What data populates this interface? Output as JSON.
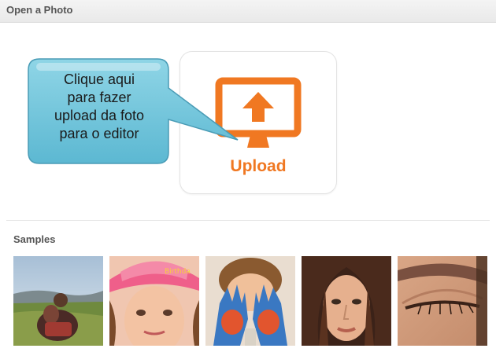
{
  "header": {
    "title": "Open a Photo"
  },
  "upload": {
    "label": "Upload",
    "icon": "monitor-upload-icon",
    "accent_color": "#f07822"
  },
  "callout": {
    "lines": [
      "Clique aqui",
      "para fazer",
      "upload da foto",
      "para o editor"
    ],
    "color": "#6cc3dc"
  },
  "samples": {
    "title": "Samples",
    "items": [
      {
        "subject": "girl-on-hill-photo"
      },
      {
        "subject": "girl-in-pink-hat-photo"
      },
      {
        "subject": "painted-hands-child-photo"
      },
      {
        "subject": "woman-portrait-photo"
      },
      {
        "subject": "eye-closeup-photo"
      }
    ]
  }
}
